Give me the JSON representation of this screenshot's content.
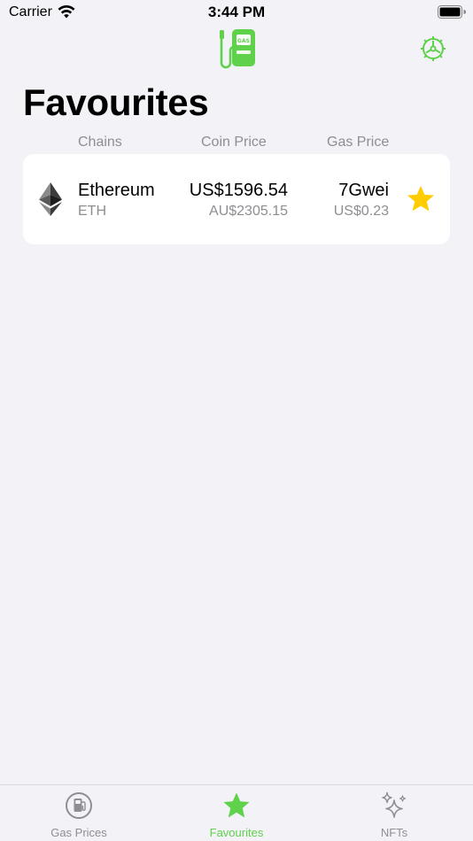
{
  "status_bar": {
    "carrier": "Carrier",
    "time": "3:44 PM"
  },
  "header": {
    "logo": "gas-pump-icon",
    "settings": "gear-icon"
  },
  "page": {
    "title": "Favourites"
  },
  "columns": {
    "chains": "Chains",
    "coin_price": "Coin Price",
    "gas_price": "Gas Price"
  },
  "favourites": [
    {
      "name": "Ethereum",
      "symbol": "ETH",
      "coin_price_usd": "US$1596.54",
      "coin_price_aud": "AU$2305.15",
      "gas_gwei": "7Gwei",
      "gas_usd": "US$0.23",
      "favourited": true
    }
  ],
  "tab_bar": {
    "tabs": [
      {
        "label": "Gas Prices",
        "icon": "gas-station-icon",
        "active": false
      },
      {
        "label": "Favourites",
        "icon": "star-icon",
        "active": true
      },
      {
        "label": "NFTs",
        "icon": "sparkles-icon",
        "active": false
      }
    ]
  },
  "colors": {
    "accent": "#5fd14b",
    "star": "#ffcc00",
    "secondary_text": "#8e8e93",
    "background": "#f2f2f7"
  }
}
